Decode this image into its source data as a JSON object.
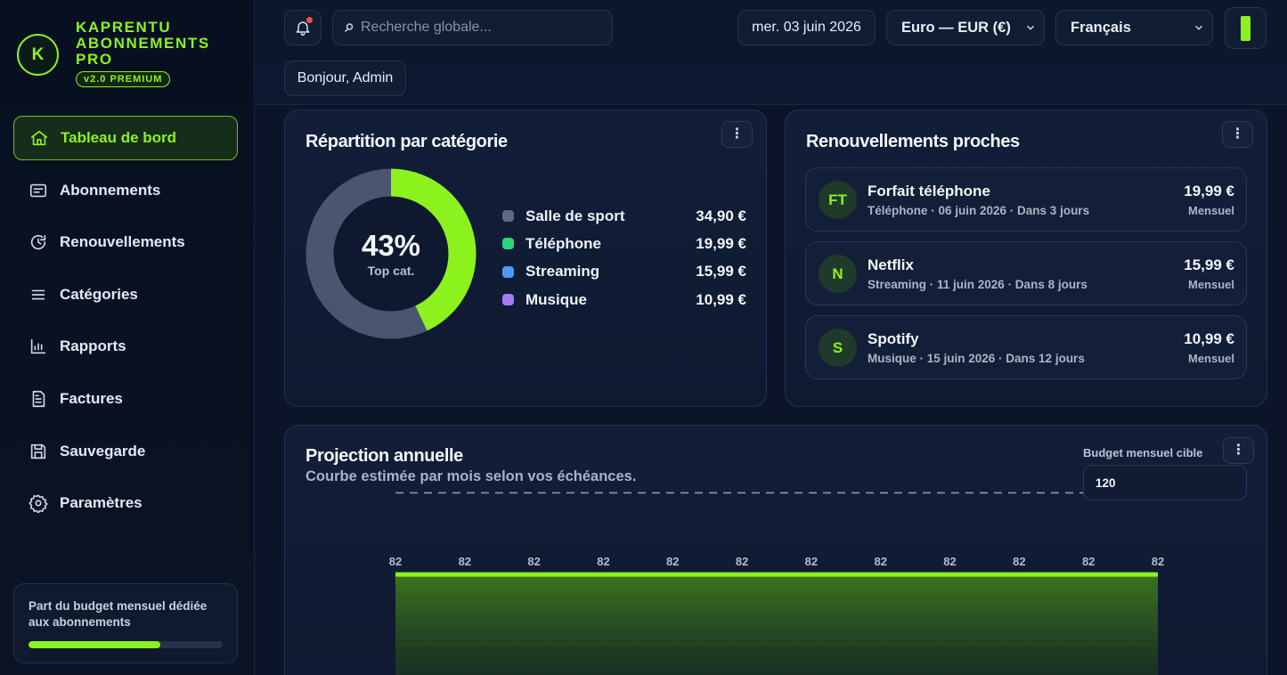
{
  "brand": {
    "logo_letter": "K",
    "name_line1": "KAPRENTU",
    "name_line2": "ABONNEMENTS",
    "name_line3": "PRO",
    "badge": "v2.0 PREMIUM"
  },
  "sidebar": {
    "items": [
      {
        "label": "Tableau de bord",
        "icon": "home-icon",
        "active": true
      },
      {
        "label": "Abonnements",
        "icon": "card-icon"
      },
      {
        "label": "Renouvellements",
        "icon": "refresh-icon"
      },
      {
        "label": "Catégories",
        "icon": "list-icon"
      },
      {
        "label": "Rapports",
        "icon": "bar-chart-icon"
      },
      {
        "label": "Factures",
        "icon": "document-icon"
      },
      {
        "label": "Sauvegarde",
        "icon": "save-icon"
      },
      {
        "label": "Paramètres",
        "icon": "gear-icon"
      }
    ],
    "budget_box": {
      "label": "Part du budget mensuel dédiée aux abonnements",
      "fraction": 0.68
    }
  },
  "header": {
    "search_placeholder": "Recherche globale...",
    "date": "mer. 03 juin 2026",
    "currency": "Euro — EUR (€)",
    "language": "Français",
    "greeting": "Bonjour, Admin",
    "notification_dot": true
  },
  "donut_card": {
    "title": "Répartition par catégorie",
    "center_value": "43%",
    "center_label": "Top cat.",
    "legend": [
      {
        "name": "Salle de sport",
        "value": "34,90 €",
        "color": "#5f6a7e"
      },
      {
        "name": "Téléphone",
        "value": "19,99 €",
        "color": "#2ad57a"
      },
      {
        "name": "Streaming",
        "value": "15,99 €",
        "color": "#4b9bf5"
      },
      {
        "name": "Musique",
        "value": "10,99 €",
        "color": "#a67cf5"
      }
    ]
  },
  "renew_card": {
    "title": "Renouvellements proches",
    "items": [
      {
        "initials": "FT",
        "name": "Forfait téléphone",
        "meta": "Téléphone · 06 juin 2026 · Dans 3 jours",
        "amount": "19,99 €",
        "period": "Mensuel"
      },
      {
        "initials": "N",
        "name": "Netflix",
        "meta": "Streaming · 11 juin 2026 · Dans 8 jours",
        "amount": "15,99 €",
        "period": "Mensuel"
      },
      {
        "initials": "S",
        "name": "Spotify",
        "meta": "Musique · 15 juin 2026 · Dans 12 jours",
        "amount": "10,99 €",
        "period": "Mensuel"
      }
    ]
  },
  "projection_card": {
    "title": "Projection annuelle",
    "subtitle": "Courbe estimée par mois selon vos échéances.",
    "budget_label": "Budget mensuel cible",
    "budget_value": "120"
  },
  "chart_data": [
    {
      "type": "pie",
      "categories": [
        "Salle de sport",
        "Téléphone",
        "Streaming",
        "Musique"
      ],
      "values": [
        34.9,
        19.99,
        15.99,
        10.99
      ],
      "highlight_fraction": 0.43,
      "colors": {
        "highlight": "#8cf21e",
        "rest": "#4a5570"
      }
    },
    {
      "type": "area",
      "values": [
        82,
        82,
        82,
        82,
        82,
        82,
        82,
        82,
        82,
        82,
        82,
        82
      ],
      "budget_line": 120,
      "colors": {
        "line": "#8cf21e",
        "budget": "#8d97a8"
      }
    }
  ]
}
